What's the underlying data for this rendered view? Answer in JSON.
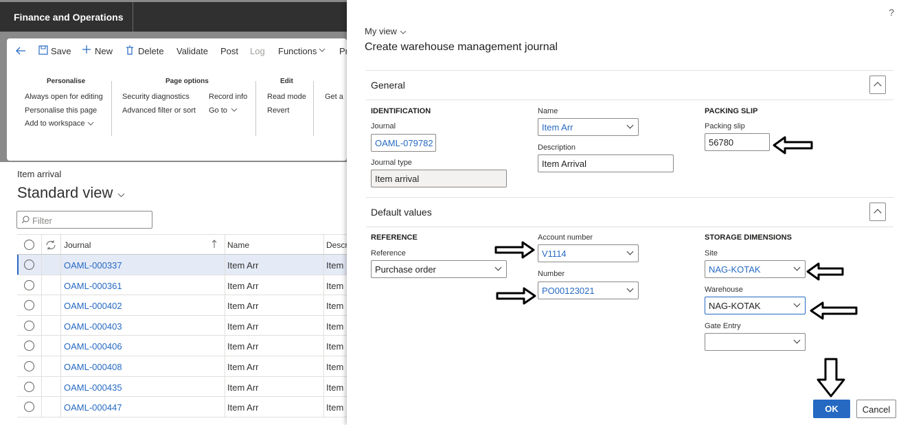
{
  "app": {
    "title": "Finance and Operations"
  },
  "toolbar": {
    "save": "Save",
    "new": "New",
    "delete": "Delete",
    "validate": "Validate",
    "post": "Post",
    "log": "Log",
    "functions": "Functions",
    "more": "Pr"
  },
  "ribbon": {
    "personalise": {
      "title": "Personalise",
      "items": [
        "Always open for editing",
        "Personalise this page",
        "Add to workspace"
      ]
    },
    "page_options": {
      "title": "Page options",
      "items": [
        "Security diagnostics",
        "Advanced filter or sort",
        "Record info",
        "Go to"
      ]
    },
    "edit": {
      "title": "Edit",
      "items": [
        "Read mode",
        "Revert"
      ]
    },
    "cut_item": "Get a"
  },
  "list": {
    "caption": "Item arrival",
    "view": "Standard view",
    "filter_placeholder": "Filter",
    "columns": {
      "journal": "Journal",
      "name": "Name",
      "desc": "Descr"
    },
    "rows": [
      {
        "journal": "OAML-000337",
        "name": "Item Arr",
        "desc": "Item"
      },
      {
        "journal": "OAML-000361",
        "name": "Item Arr",
        "desc": "Item"
      },
      {
        "journal": "OAML-000402",
        "name": "Item Arr",
        "desc": "Item"
      },
      {
        "journal": "OAML-000403",
        "name": "Item Arr",
        "desc": "Item"
      },
      {
        "journal": "OAML-000406",
        "name": "Item Arr",
        "desc": "Item"
      },
      {
        "journal": "OAML-000408",
        "name": "Item Arr",
        "desc": "Item"
      },
      {
        "journal": "OAML-000435",
        "name": "Item Arr",
        "desc": "Item"
      },
      {
        "journal": "OAML-000447",
        "name": "Item Arr",
        "desc": "Item"
      }
    ]
  },
  "dialog": {
    "help": "?",
    "my_view": "My view",
    "title": "Create warehouse management journal",
    "general": {
      "title": "General",
      "identification": "IDENTIFICATION",
      "journal_label": "Journal",
      "journal_value": "OAML-079782",
      "journal_type_label": "Journal type",
      "journal_type_value": "Item arrival",
      "name_label": "Name",
      "name_value": "Item Arr",
      "description_label": "Description",
      "description_value": "Item Arrival",
      "packing_slip_group": "PACKING SLIP",
      "packing_slip_label": "Packing slip",
      "packing_slip_value": "56780"
    },
    "defaults": {
      "title": "Default values",
      "reference_group": "REFERENCE",
      "reference_label": "Reference",
      "reference_value": "Purchase order",
      "account_label": "Account number",
      "account_value": "V1114",
      "number_label": "Number",
      "number_value": "PO00123021",
      "storage_group": "STORAGE DIMENSIONS",
      "site_label": "Site",
      "site_value": "NAG-KOTAK",
      "warehouse_label": "Warehouse",
      "warehouse_value": "NAG-KOTAK",
      "gate_label": "Gate Entry",
      "gate_value": ""
    },
    "ok": "OK",
    "cancel": "Cancel"
  },
  "colors": {
    "accent": "#2569c3",
    "topbar": "#303030"
  }
}
